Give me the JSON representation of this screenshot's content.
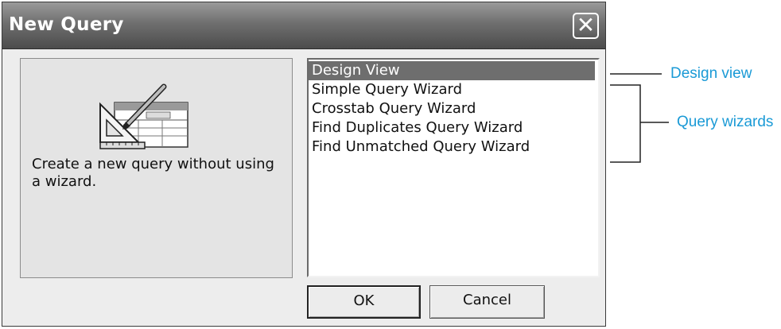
{
  "dialog": {
    "title": "New Query",
    "close_symbol": "✕"
  },
  "preview": {
    "icon": "design-view-query-icon",
    "description": "Create a new query without using a wizard."
  },
  "query_list": {
    "items": [
      "Design View",
      "Simple Query Wizard",
      "Crosstab Query Wizard",
      "Find Duplicates Query Wizard",
      "Find Unmatched Query Wizard"
    ],
    "selected_index": 0
  },
  "buttons": {
    "ok": "OK",
    "cancel": "Cancel"
  },
  "callouts": {
    "design_view": "Design view",
    "query_wizards": "Query wizards",
    "color": "#1a9ad6"
  }
}
